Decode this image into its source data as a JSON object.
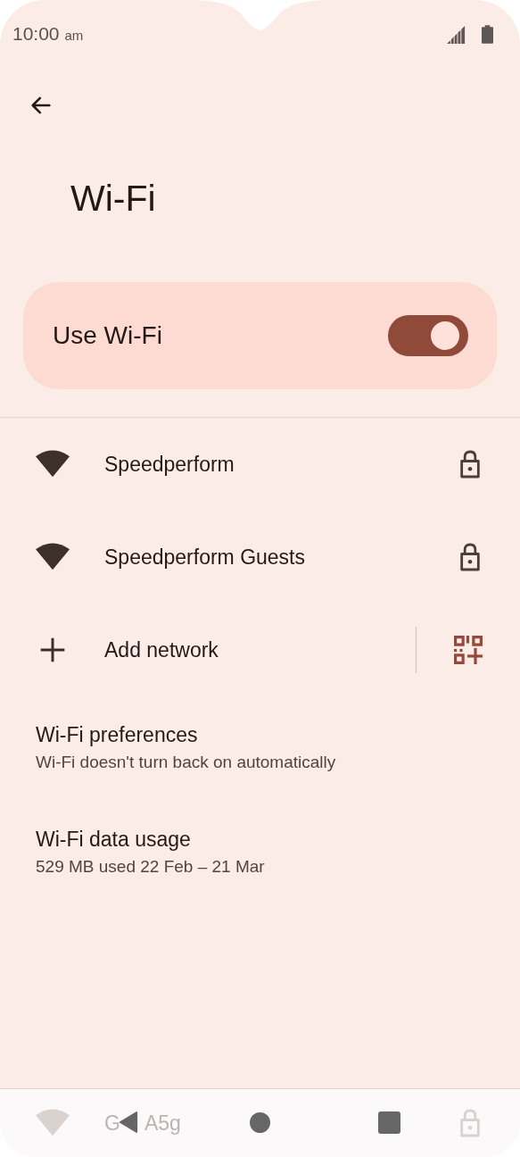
{
  "status_bar": {
    "time": "10:00",
    "suffix": "am"
  },
  "title": "Wi-Fi",
  "master_switch": {
    "label": "Use Wi-Fi",
    "on": true
  },
  "networks": [
    {
      "name": "Speedperform",
      "secured": true
    },
    {
      "name": "Speedperform Guests",
      "secured": true
    }
  ],
  "add_network": {
    "label": "Add network"
  },
  "settings": [
    {
      "title": "Wi-Fi preferences",
      "summary": "Wi-Fi doesn't turn back on automatically"
    },
    {
      "title": "Wi-Fi data usage",
      "summary": "529 MB used 22 Feb – 21 Mar"
    }
  ],
  "partial_network": {
    "name_start": "G",
    "name_end": "A5g",
    "secured": true
  }
}
